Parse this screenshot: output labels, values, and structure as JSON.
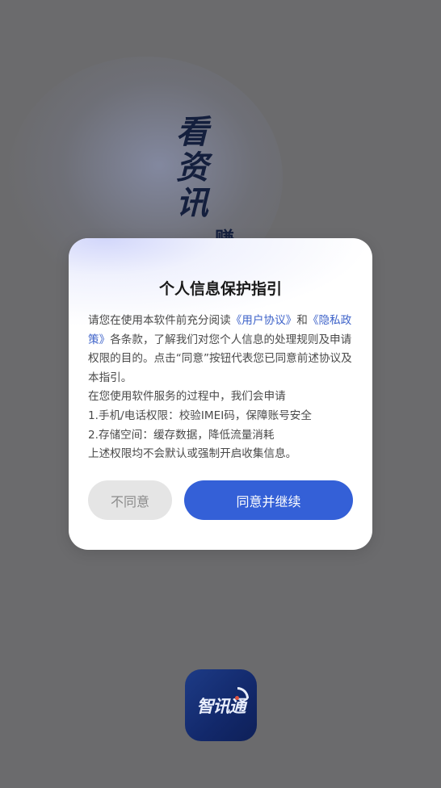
{
  "splash": {
    "slogan": "看资讯",
    "slogan_extra": "赚"
  },
  "dialog": {
    "title": "个人信息保护指引",
    "body_intro_1": "请您在使用本软件前充分阅读",
    "link_user_agreement": "《用户协议》",
    "body_and": "和",
    "link_privacy_policy": "《隐私政策》",
    "body_intro_2": "各条款，了解我们对您个人信息的处理规则及申请权限的目的。点击“同意”按钮代表您已同意前述协议及本指引。",
    "line_service": "在您使用软件服务的过程中，我们会申请",
    "line_perm_1": "1.手机/电话权限：校验IMEI码，保障账号安全",
    "line_perm_2": "2.存储空间：缓存数据，降低流量消耗",
    "line_note": "上述权限均不会默认或强制开启收集信息。",
    "disagree_label": "不同意",
    "agree_label": "同意并继续"
  },
  "app_icon": {
    "label": "智讯通"
  },
  "colors": {
    "overlay": "#6b6b6d",
    "accent": "#3460d7",
    "link": "#3d62c9",
    "icon_bg": "#1d3b86"
  }
}
